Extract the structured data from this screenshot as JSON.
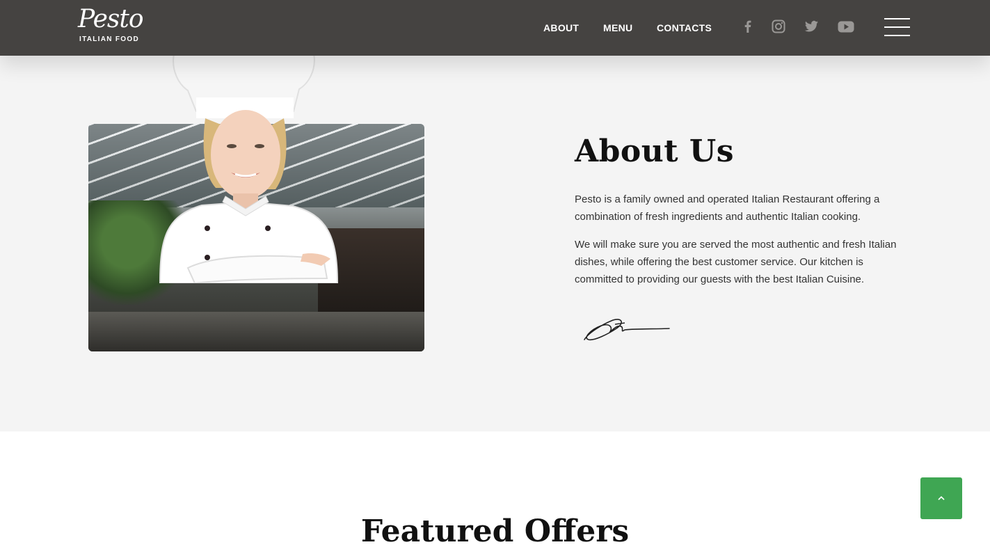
{
  "header": {
    "logo_script": "Pesto",
    "logo_sub": "ITALIAN FOOD",
    "nav": [
      "ABOUT",
      "MENU",
      "CONTACTS"
    ],
    "social_icons": [
      "facebook-icon",
      "instagram-icon",
      "twitter-icon",
      "youtube-icon"
    ],
    "menu_icon": "hamburger-menu-icon"
  },
  "about": {
    "title": "About Us",
    "paragraph_1": "Pesto is a family owned and operated Italian Restaurant offering a combination of fresh ingredients and authentic Italian cooking.",
    "paragraph_2": "We will make sure you are served the most authentic and fresh Italian dishes, while offering the best customer service. Our kitchen is committed to providing our guests with the best Italian Cuisine."
  },
  "featured": {
    "title": "Featured Offers"
  },
  "colors": {
    "header_bg": "#454341",
    "section_bg": "#f4f4f4",
    "accent_green": "#3fa653",
    "heading": "#111111"
  },
  "scroll_top_icon": "chevron-up-icon"
}
